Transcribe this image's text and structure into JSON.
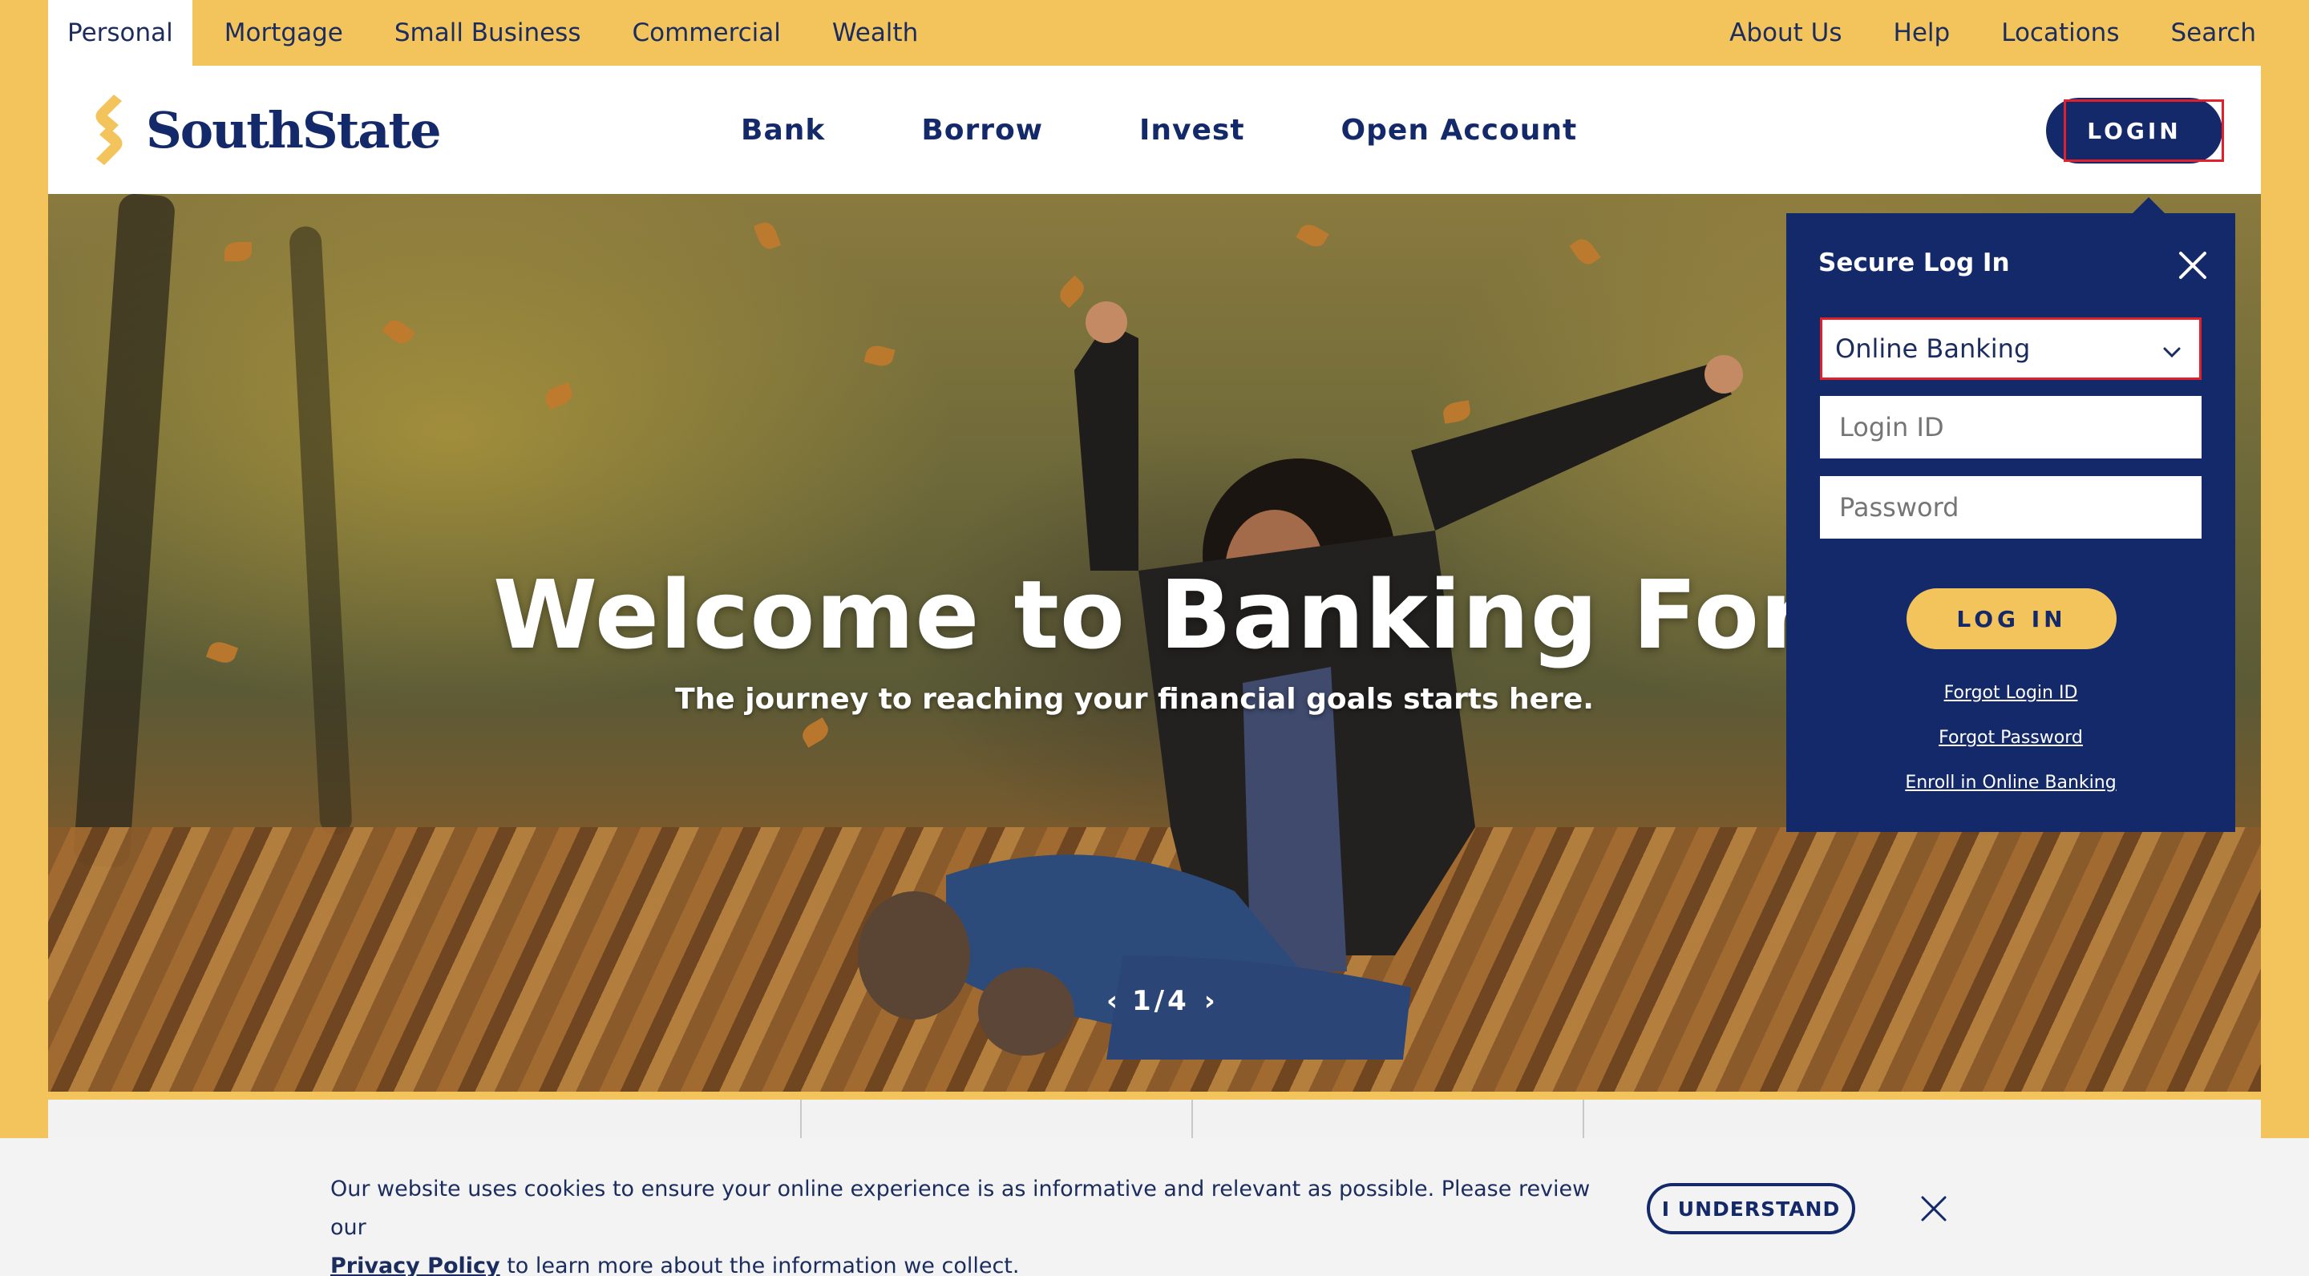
{
  "topbar": {
    "left_links": [
      "Personal",
      "Mortgage",
      "Small Business",
      "Commercial",
      "Wealth"
    ],
    "right_links": [
      "About Us",
      "Help",
      "Locations",
      "Search"
    ]
  },
  "brand": {
    "name": "SouthState"
  },
  "nav": {
    "links": [
      "Bank",
      "Borrow",
      "Invest",
      "Open Account"
    ],
    "login_label": "LOGIN"
  },
  "hero": {
    "title": "Welcome to Banking Forward",
    "subtitle": "The journey to reaching your financial goals starts here.",
    "pager": "1/4"
  },
  "login_panel": {
    "title": "Secure Log In",
    "account_type": "Online Banking",
    "login_id_placeholder": "Login ID",
    "password_placeholder": "Password",
    "submit_label": "LOG IN",
    "links": [
      "Forgot Login ID",
      "Forgot Password",
      "Enroll in Online Banking"
    ]
  },
  "cookie": {
    "text_before": "Our website uses cookies to ensure your online experience is as informative and relevant as possible. Please review our",
    "policy_link": "Privacy Policy",
    "text_after": " to learn more about the information we collect.",
    "button_label": "I UNDERSTAND"
  },
  "colors": {
    "brand_navy": "#14296a",
    "brand_gold": "#f3c45c"
  },
  "icons": {
    "logo": "southstate-logo-mark",
    "close": "close-icon",
    "dropdown": "chevron-down-icon",
    "prev": "chevron-left-icon",
    "next": "chevron-right-icon"
  }
}
